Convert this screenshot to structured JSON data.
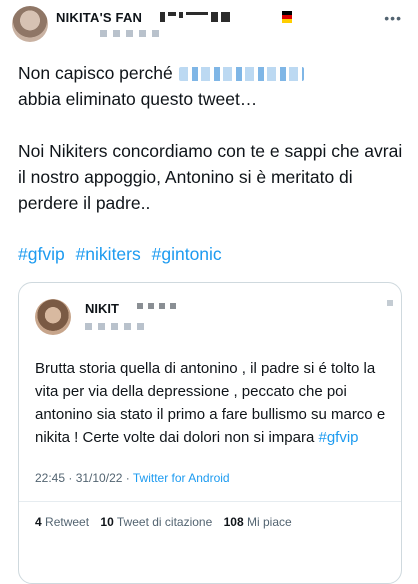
{
  "tweet": {
    "author_name": "NIKITA'S FAN",
    "more_icon": "more-horizontal-icon",
    "body_line1": "Non capisco perché",
    "body_line1b": "abbia eliminato questo tweet…",
    "body_para2": "Noi Nikiters concordiamo con te e sappi che avrai il nostro appoggio, Antonino si è meritato di perdere il padre..",
    "hashtags": [
      "#gfvip",
      "#nikiters",
      "#gintonic"
    ],
    "accent_color": "#1d9bf0"
  },
  "quoted_tweet": {
    "author_name": "NIKIT",
    "text_main": "Brutta storia quella di antonino , il padre si é tolto la vita per via della depressione , peccato che poi antonino sia stato il primo a fare bullismo su marco e nikita ! Certe volte dai dolori non si impara ",
    "hashtag": "#gfvip",
    "time": "22:45",
    "date": "31/10/22",
    "source": "Twitter for Android",
    "stats": [
      {
        "count": "4",
        "label": "Retweet"
      },
      {
        "count": "10",
        "label": "Tweet di citazione"
      },
      {
        "count": "108",
        "label": "Mi piace"
      }
    ]
  }
}
